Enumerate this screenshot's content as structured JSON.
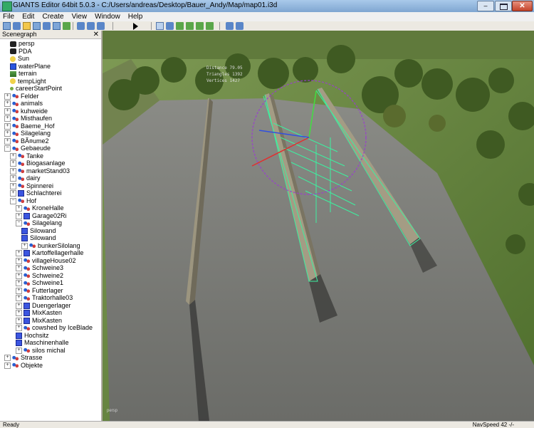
{
  "window": {
    "title": "GIANTS Editor 64bit 5.0.3 - C:/Users/andreas/Desktop/Bauer_Andy/Map/map01.i3d",
    "minimize_label": "–",
    "close_label": "✕"
  },
  "menu": [
    "File",
    "Edit",
    "Create",
    "View",
    "Window",
    "Help"
  ],
  "scenegraph": {
    "title": "Scenegraph",
    "close": "✕",
    "items": [
      {
        "label": "persp",
        "icon": "camera-icon"
      },
      {
        "label": "PDA",
        "icon": "camera-icon"
      },
      {
        "label": "Sun",
        "icon": "light-icon"
      },
      {
        "label": "waterPlane",
        "icon": "water-icon"
      },
      {
        "label": "terrain",
        "icon": "terrain-icon"
      },
      {
        "label": "tempLight",
        "icon": "light-icon"
      },
      {
        "label": "careerStartPoint",
        "icon": "point-icon"
      },
      {
        "label": "Felder",
        "icon": "group-icon",
        "expander": "+"
      },
      {
        "label": "animals",
        "icon": "group-icon",
        "expander": "+"
      },
      {
        "label": "kuhweide",
        "icon": "group-icon",
        "expander": "+"
      },
      {
        "label": "Misthaufen",
        "icon": "group-icon",
        "expander": "+"
      },
      {
        "label": "Baeme_Hof",
        "icon": "group-icon",
        "expander": "+"
      },
      {
        "label": "Silagelang",
        "icon": "group-icon",
        "expander": "+"
      },
      {
        "label": "BÃ¤ume2",
        "icon": "group-icon",
        "expander": "+"
      },
      {
        "label": "Gebaeude",
        "icon": "group-icon",
        "expander": "−"
      },
      {
        "label": "Tanke",
        "icon": "group-icon",
        "expander": "+"
      },
      {
        "label": "Biogasanlage",
        "icon": "group-icon",
        "expander": "+"
      },
      {
        "label": "marketStand03",
        "icon": "group-icon",
        "expander": "+"
      },
      {
        "label": "dairy",
        "icon": "group-icon",
        "expander": "+"
      },
      {
        "label": "Spinnerei",
        "icon": "group-icon",
        "expander": "+"
      },
      {
        "label": "Schlachterei",
        "icon": "cube-icon",
        "expander": "+"
      },
      {
        "label": "Hof",
        "icon": "group-icon",
        "expander": "−"
      },
      {
        "label": "KroneHalle",
        "icon": "group-icon",
        "expander": "+"
      },
      {
        "label": "Garage02Ri",
        "icon": "cube-icon",
        "expander": "+"
      },
      {
        "label": "Silagelang",
        "icon": "group-icon",
        "expander": "−"
      },
      {
        "label": "Silowand",
        "icon": "cube-icon"
      },
      {
        "label": "Silowand",
        "icon": "cube-icon"
      },
      {
        "label": "bunkerSilolang",
        "icon": "group-icon",
        "expander": "+"
      },
      {
        "label": "Kartoffellagerhalle",
        "icon": "cube-icon",
        "expander": "+"
      },
      {
        "label": "villageHouse02",
        "icon": "group-icon",
        "expander": "+"
      },
      {
        "label": "Schweine3",
        "icon": "group-icon",
        "expander": "+"
      },
      {
        "label": "Schweine2",
        "icon": "group-icon",
        "expander": "+"
      },
      {
        "label": "Schweine1",
        "icon": "group-icon",
        "expander": "+"
      },
      {
        "label": "Futterlager",
        "icon": "group-icon",
        "expander": "+"
      },
      {
        "label": "Traktorhalle03",
        "icon": "group-icon",
        "expander": "+"
      },
      {
        "label": "Duengerlager",
        "icon": "cube-icon",
        "expander": "+"
      },
      {
        "label": "MixKasten",
        "icon": "cube-icon",
        "expander": "+"
      },
      {
        "label": "MixKasten",
        "icon": "cube-icon",
        "expander": "+"
      },
      {
        "label": "cowshed by IceBlade",
        "icon": "group-icon",
        "expander": "+"
      },
      {
        "label": "Hochsitz",
        "icon": "cube-icon"
      },
      {
        "label": "Maschinenhalle",
        "icon": "cube-icon"
      },
      {
        "label": "silos michal",
        "icon": "group-icon",
        "expander": "+"
      },
      {
        "label": "Strasse",
        "icon": "group-icon",
        "expander": "+"
      },
      {
        "label": "Objekte",
        "icon": "group-icon",
        "expander": "+"
      }
    ]
  },
  "viewport": {
    "stats": [
      "Distance 79.05",
      "Triangles 1392",
      "Vertices 1427"
    ],
    "corner_label": "persp"
  },
  "status": {
    "left": "Ready",
    "right": "NavSpeed 42  -/-"
  }
}
